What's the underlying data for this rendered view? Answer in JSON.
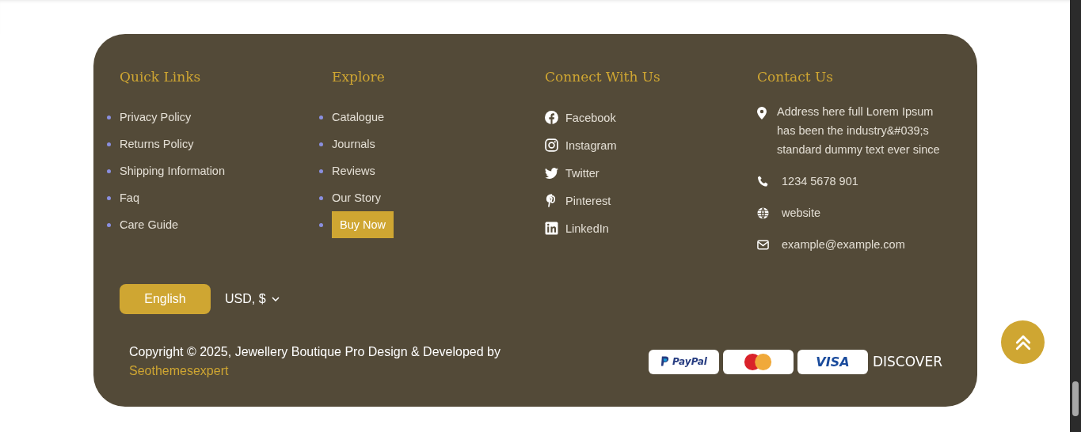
{
  "columns": [
    {
      "title": "Quick Links",
      "kind": "links",
      "items": [
        {
          "label": "Privacy Policy",
          "highlighted": false
        },
        {
          "label": "Returns Policy",
          "highlighted": false
        },
        {
          "label": "Shipping Information",
          "highlighted": false
        },
        {
          "label": "Faq",
          "highlighted": false
        },
        {
          "label": "Care Guide",
          "highlighted": false
        }
      ]
    },
    {
      "title": "Explore",
      "kind": "links",
      "items": [
        {
          "label": "Catalogue",
          "highlighted": false
        },
        {
          "label": "Journals",
          "highlighted": false
        },
        {
          "label": "Reviews",
          "highlighted": false
        },
        {
          "label": "Our Story",
          "highlighted": false
        },
        {
          "label": "Buy Now",
          "highlighted": true
        }
      ]
    },
    {
      "title": "Connect With Us",
      "kind": "social",
      "items": [
        {
          "label": "Facebook",
          "kind": "facebook"
        },
        {
          "label": "Instagram",
          "kind": "instagram"
        },
        {
          "label": "Twitter",
          "kind": "twitter"
        },
        {
          "label": "Pinterest",
          "kind": "pinterest"
        },
        {
          "label": "LinkedIn",
          "kind": "linkedin"
        }
      ]
    },
    {
      "title": "Contact Us",
      "kind": "contact",
      "items": [
        {
          "label": "Address here full Lorem Ipsum has been the industry&#039;s standard dummy text ever since",
          "kind": "address"
        },
        {
          "label": "1234 5678 901",
          "kind": "phone"
        },
        {
          "label": "website",
          "kind": "web"
        },
        {
          "label": "example@example.com",
          "kind": "email"
        }
      ]
    }
  ],
  "language_button": "English",
  "currency": "USD, $",
  "copyright": "Copyright © 2025, Jewellery Boutique Pro Design & Developed by",
  "developer_link": "Seothemesexpert",
  "payments": [
    {
      "kind": "paypal",
      "label": "PayPal"
    },
    {
      "kind": "mastercard"
    },
    {
      "kind": "visa",
      "label": "VISA"
    },
    {
      "kind": "discover",
      "label": "DISCOVER"
    }
  ]
}
